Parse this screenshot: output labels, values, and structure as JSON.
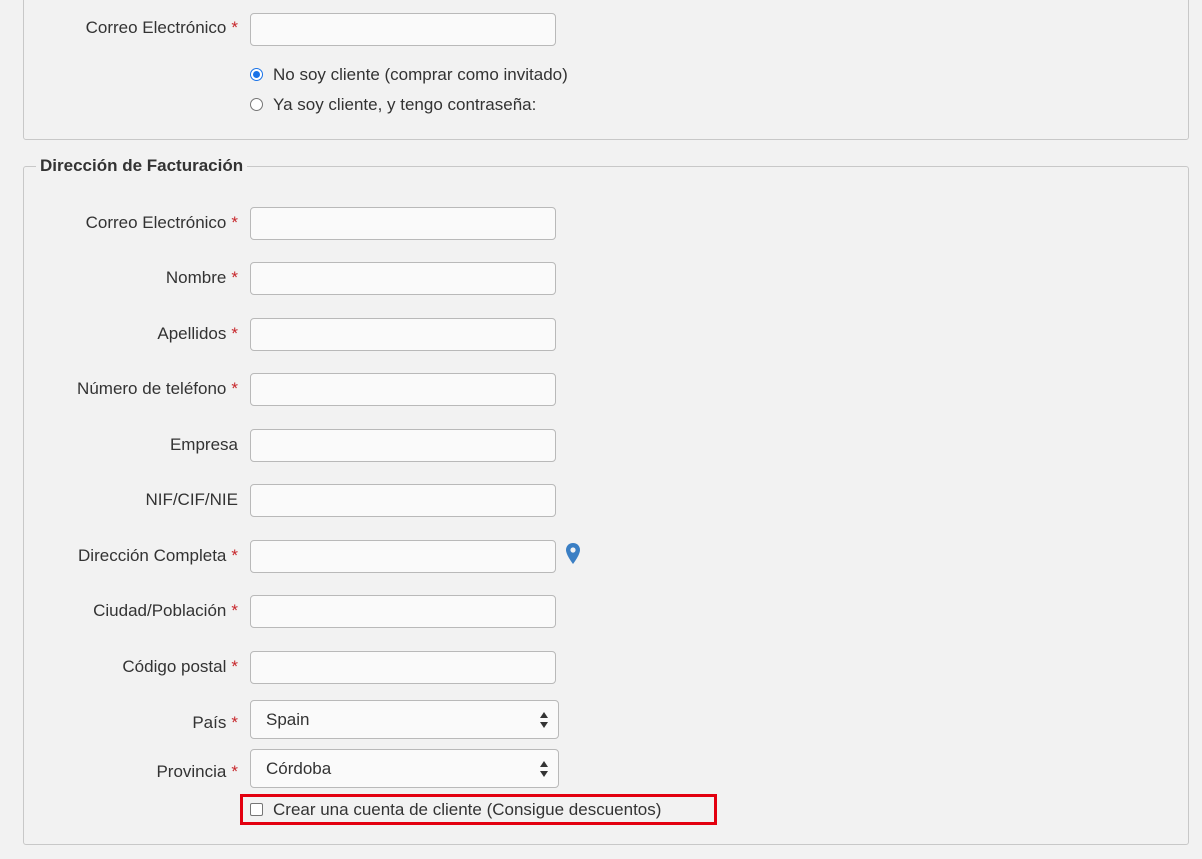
{
  "top_section": {
    "email_label": "Correo Electrónico",
    "required_mark": "*",
    "email_value": "",
    "radio_options": [
      {
        "label": "No soy cliente (comprar como invitado)",
        "checked": true
      },
      {
        "label": "Ya soy cliente, y tengo contraseña:",
        "checked": false
      }
    ]
  },
  "billing": {
    "legend": "Dirección de Facturación",
    "fields": [
      {
        "label": "Correo Electrónico",
        "required": "*",
        "value": ""
      },
      {
        "label": "Nombre",
        "required": "*",
        "value": ""
      },
      {
        "label": "Apellidos",
        "required": "*",
        "value": ""
      },
      {
        "label": "Número de teléfono",
        "required": "*",
        "value": ""
      },
      {
        "label": "Empresa",
        "required": "",
        "value": ""
      },
      {
        "label": "NIF/CIF/NIE",
        "required": "",
        "value": ""
      },
      {
        "label": "Dirección Completa",
        "required": "*",
        "value": ""
      },
      {
        "label": "Ciudad/Población",
        "required": "*",
        "value": ""
      },
      {
        "label": "Código postal",
        "required": "*",
        "value": ""
      }
    ],
    "country": {
      "label": "País",
      "required": "*",
      "selected": "Spain"
    },
    "province": {
      "label": "Provincia",
      "required": "*",
      "selected": "Córdoba"
    },
    "create_account_label": "Crear una cuenta de cliente (Consigue descuentos)",
    "create_account_checked": false,
    "location_icon": "map-marker-icon",
    "highlight_color": "#e3000f"
  }
}
